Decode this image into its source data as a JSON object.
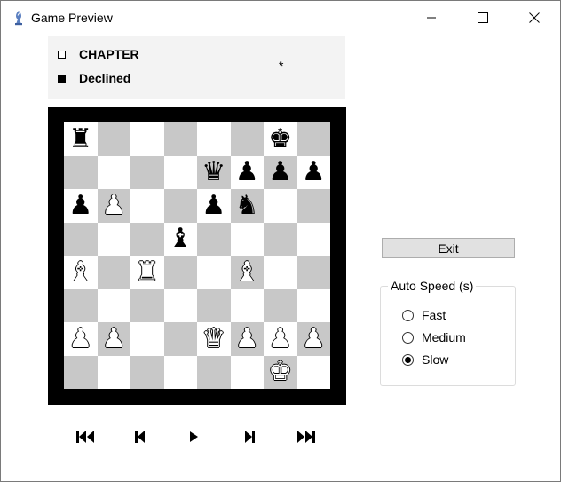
{
  "window": {
    "title": "Game Preview",
    "app_icon": "chess-bishop-icon"
  },
  "players": {
    "white_label": "CHAPTER",
    "black_label": "Declined",
    "result": "*"
  },
  "board": {
    "ranks": [
      [
        "r",
        "",
        "",
        "",
        "",
        "",
        "k",
        ""
      ],
      [
        "",
        "",
        "",
        "",
        "q",
        "p",
        "p",
        "p"
      ],
      [
        "p",
        "P",
        "",
        "",
        "p",
        "n",
        "",
        ""
      ],
      [
        "",
        "",
        "",
        "b",
        "",
        "",
        "",
        ""
      ],
      [
        "B",
        "",
        "R",
        "",
        "",
        "B",
        "",
        ""
      ],
      [
        "",
        "",
        "",
        "",
        "",
        "",
        "",
        ""
      ],
      [
        "P",
        "P",
        "",
        "",
        "Q",
        "P",
        "P",
        "P"
      ],
      [
        "",
        "",
        "",
        "",
        "",
        "",
        "K",
        ""
      ]
    ],
    "highlighted_square": "g1"
  },
  "navigation": {
    "buttons": [
      "first-move-icon",
      "previous-move-icon",
      "play-icon",
      "next-move-icon",
      "last-move-icon"
    ]
  },
  "controls": {
    "exit_label": "Exit",
    "speed_legend": "Auto Speed (s)",
    "speed_options": [
      "Fast",
      "Medium",
      "Slow"
    ],
    "selected_speed": "Slow"
  }
}
